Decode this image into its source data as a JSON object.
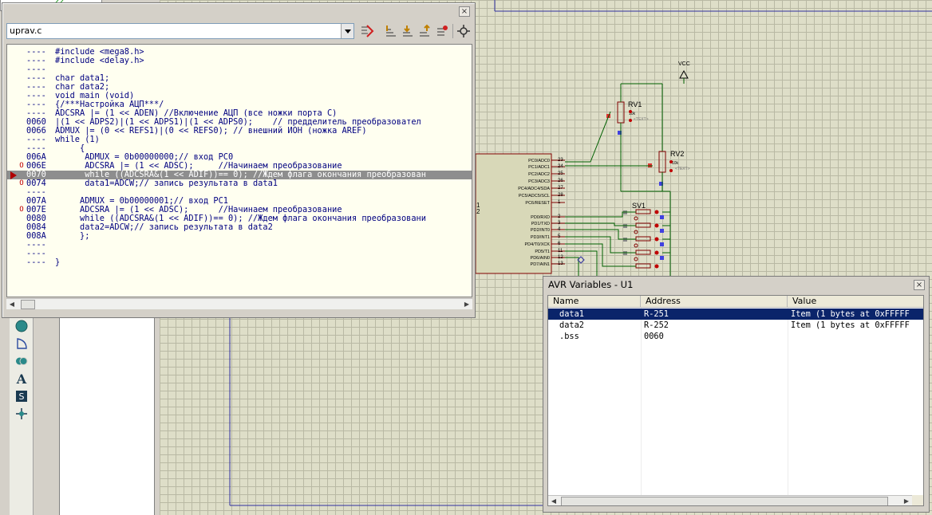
{
  "source_window": {
    "file_name": "uprav.c",
    "close_label": "×",
    "lines": [
      {
        "addr": "----",
        "code": "#include <mega8.h>",
        "mark": "",
        "highlight": false
      },
      {
        "addr": "----",
        "code": "#include <delay.h>",
        "mark": "",
        "highlight": false
      },
      {
        "addr": "----",
        "code": "",
        "mark": "",
        "highlight": false
      },
      {
        "addr": "----",
        "code": "char data1;",
        "mark": "",
        "highlight": false
      },
      {
        "addr": "----",
        "code": "char data2;",
        "mark": "",
        "highlight": false
      },
      {
        "addr": "----",
        "code": "void main (void)",
        "mark": "",
        "highlight": false
      },
      {
        "addr": "----",
        "code": "{/***Настройка АЦП***/",
        "mark": "",
        "highlight": false
      },
      {
        "addr": "----",
        "code": "ADCSRA |= (1 << ADEN) //Включение АЦП (все ножки порта С)",
        "mark": "",
        "highlight": false
      },
      {
        "addr": "0060",
        "code": "|(1 << ADPS2)|(1 << ADPS1)|(1 << ADPS0);    // предделитель преобразовател",
        "mark": "",
        "highlight": false
      },
      {
        "addr": "0066",
        "code": "ADMUX |= (0 << REFS1)|(0 << REFS0); // внешний ИОН (ножка AREF)",
        "mark": "",
        "highlight": false
      },
      {
        "addr": "----",
        "code": "while (1)",
        "mark": "",
        "highlight": false
      },
      {
        "addr": "----",
        "code": "     {",
        "mark": "",
        "highlight": false
      },
      {
        "addr": "006A",
        "code": "      ADMUX = 0b00000000;// вход PC0",
        "mark": "",
        "highlight": false
      },
      {
        "addr": "006E",
        "code": "      ADCSRA |= (1 << ADSC);     //Начинаем преобразование",
        "mark": "O",
        "highlight": false
      },
      {
        "addr": "0070",
        "code": "      while ((ADCSRA&(1 << ADIF))== 0); //Ждем флага окончания преобразован",
        "mark": "",
        "highlight": true
      },
      {
        "addr": "0074",
        "code": "      data1=ADCW;// запись результата в data1",
        "mark": "O",
        "highlight": false
      },
      {
        "addr": "----",
        "code": "",
        "mark": "",
        "highlight": false
      },
      {
        "addr": "007A",
        "code": "     ADMUX = 0b00000001;// вход PC1",
        "mark": "",
        "highlight": false
      },
      {
        "addr": "007E",
        "code": "     ADCSRA |= (1 << ADSC);      //Начинаем преобразование",
        "mark": "O",
        "highlight": false
      },
      {
        "addr": "0080",
        "code": "     while ((ADCSRA&(1 << ADIF))== 0); //Ждем флага окончания преобразовани",
        "mark": "",
        "highlight": false
      },
      {
        "addr": "0084",
        "code": "     data2=ADCW;// запись результата в data2",
        "mark": "",
        "highlight": false
      },
      {
        "addr": "008A",
        "code": "     };",
        "mark": "",
        "highlight": false
      },
      {
        "addr": "----",
        "code": "",
        "mark": "",
        "highlight": false
      },
      {
        "addr": "----",
        "code": "",
        "mark": "",
        "highlight": false
      },
      {
        "addr": "----",
        "code": "}",
        "mark": "",
        "highlight": false
      }
    ]
  },
  "avr_window": {
    "title": "AVR Variables - U1",
    "close_label": "×",
    "columns": [
      "Name",
      "Address",
      "Value"
    ],
    "rows": [
      {
        "name": "data1",
        "address": "R-251",
        "value": "Item (1 bytes at 0xFFFFF",
        "selected": true
      },
      {
        "name": "data2",
        "address": "R-252",
        "value": "Item (1 bytes at 0xFFFFF",
        "selected": false
      },
      {
        "name": ".bss",
        "address": "0060",
        "value": "",
        "selected": false
      }
    ]
  },
  "schematic": {
    "vcc_label": "VCC",
    "rv1_label": "RV1",
    "rv2_label": "RV2",
    "rv_value": "10k",
    "rv_text": "<TEXT>",
    "sv1_label": "SV1",
    "mcu_pins": [
      "PC0/ADC0",
      "PC1/ADC1",
      "PC2/ADC2",
      "PC3/ADC3",
      "PC4/ADC4/SDA",
      "PC5/ADC5/SCL",
      "PC6/RESET",
      "PD0/RXD",
      "PD1/TXD",
      "PD2/INT0",
      "PD3/INT1",
      "PD4/T0/XCK",
      "PD5/T1",
      "PD6/AIN0",
      "PD7/AIN1"
    ],
    "mcu_pin_numbers": [
      "23",
      "24",
      "25",
      "26",
      "27",
      "28",
      "1",
      "2",
      "3",
      "4",
      "5",
      "6",
      "11",
      "12",
      "13"
    ]
  },
  "colors": {
    "highlight_row": "#8e8e8e",
    "selected_row": "#0a246a",
    "code_bg": "#fffff0",
    "wire": "#006000",
    "component": "#800000"
  }
}
